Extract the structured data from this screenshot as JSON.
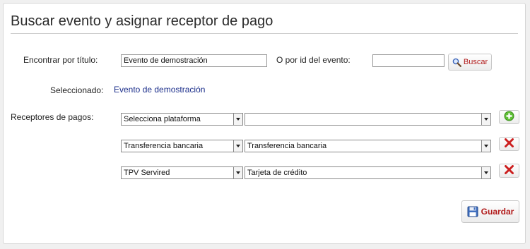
{
  "page": {
    "title": "Buscar evento y asignar receptor de pago"
  },
  "search": {
    "title_label": "Encontrar por título:",
    "title_value": "Evento de demostración",
    "id_label": "O por id del evento:",
    "id_value": "",
    "search_button": "Buscar"
  },
  "selection": {
    "label": "Seleccionado:",
    "value": "Evento de demostración"
  },
  "receivers": {
    "label": "Receptores de pagos:",
    "rows": [
      {
        "platform": "Selecciona plataforma",
        "method": "",
        "action": "add"
      },
      {
        "platform": "Transferencia bancaria",
        "method": "Transferencia bancaria",
        "action": "remove"
      },
      {
        "platform": "TPV Servired",
        "method": "Tarjeta de crédito",
        "action": "remove"
      }
    ]
  },
  "save_button": "Guardar",
  "colors": {
    "accent_red": "#b11b1b",
    "link_blue": "#1a2d8a",
    "add_green": "#4caf2a",
    "remove_red": "#cc1f1f"
  }
}
